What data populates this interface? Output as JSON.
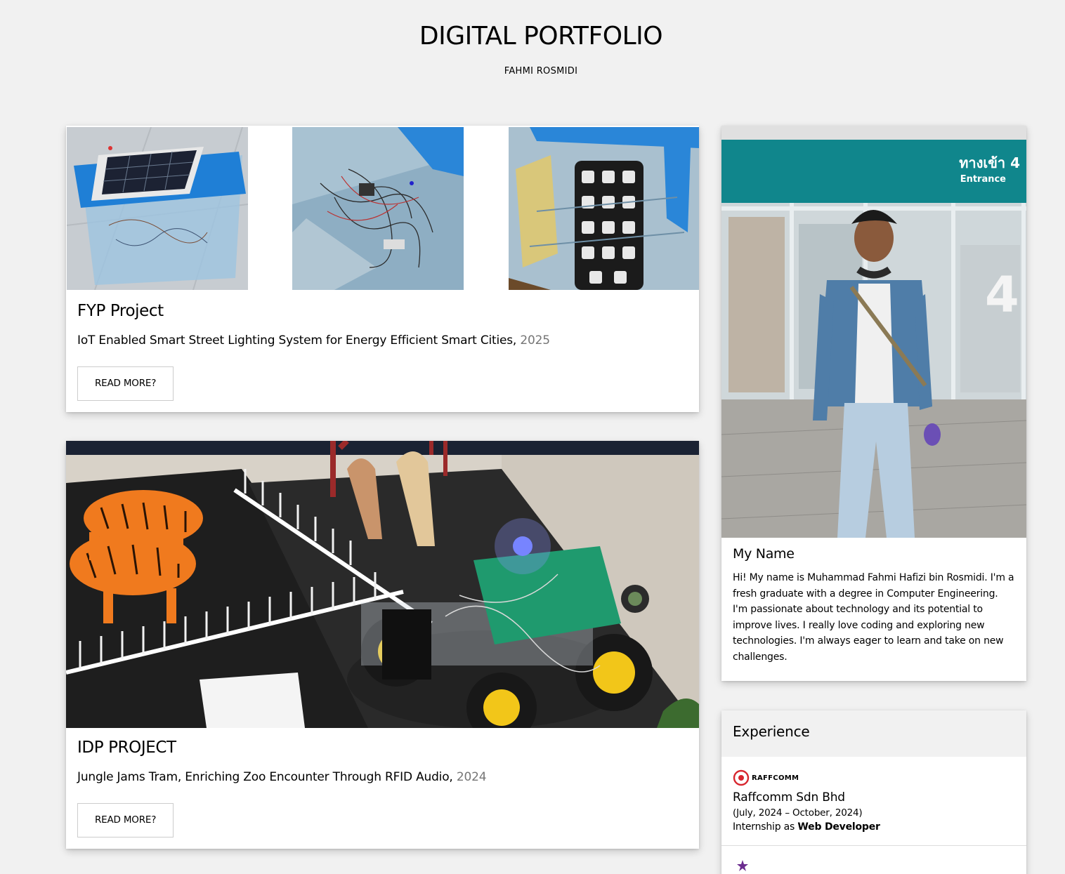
{
  "header": {
    "title": "DIGITAL PORTFOLIO",
    "subtitle": "FAHMI ROSMIDI"
  },
  "projects": [
    {
      "title": "FYP Project",
      "description": "IoT Enabled Smart Street Lighting System for Energy Efficient Smart Cities,",
      "year": "2025",
      "button": "READ MORE?"
    },
    {
      "title": "IDP PROJECT",
      "description": "Jungle Jams Tram, Enriching Zoo Encounter Through RFID Audio,",
      "year": "2024",
      "button": "READ MORE?"
    }
  ],
  "profile": {
    "sign_text": "ทางเข้า 4",
    "sign_sub": "Entrance",
    "title": "My Name",
    "bio": "Hi! My name is Muhammad Fahmi Hafizi bin Rosmidi. I'm a fresh graduate with a degree in Computer Engineering. I'm passionate about technology and its potential to improve lives. I really love coding and exploring new technologies. I'm always eager to learn and take on new challenges."
  },
  "experience": {
    "heading": "Experience",
    "items": [
      {
        "logo_text": "RAFFCOMM",
        "company": "Raffcomm Sdn Bhd",
        "dates": "(July, 2024 – October, 2024)",
        "role_prefix": "Internship as",
        "role": "Web Developer"
      }
    ]
  },
  "colors": {
    "page_bg": "#f1f1f1",
    "card_bg": "#ffffff",
    "muted_text": "#757575",
    "logo_red": "#d7262e",
    "teal_sign": "#0f8a8f"
  }
}
